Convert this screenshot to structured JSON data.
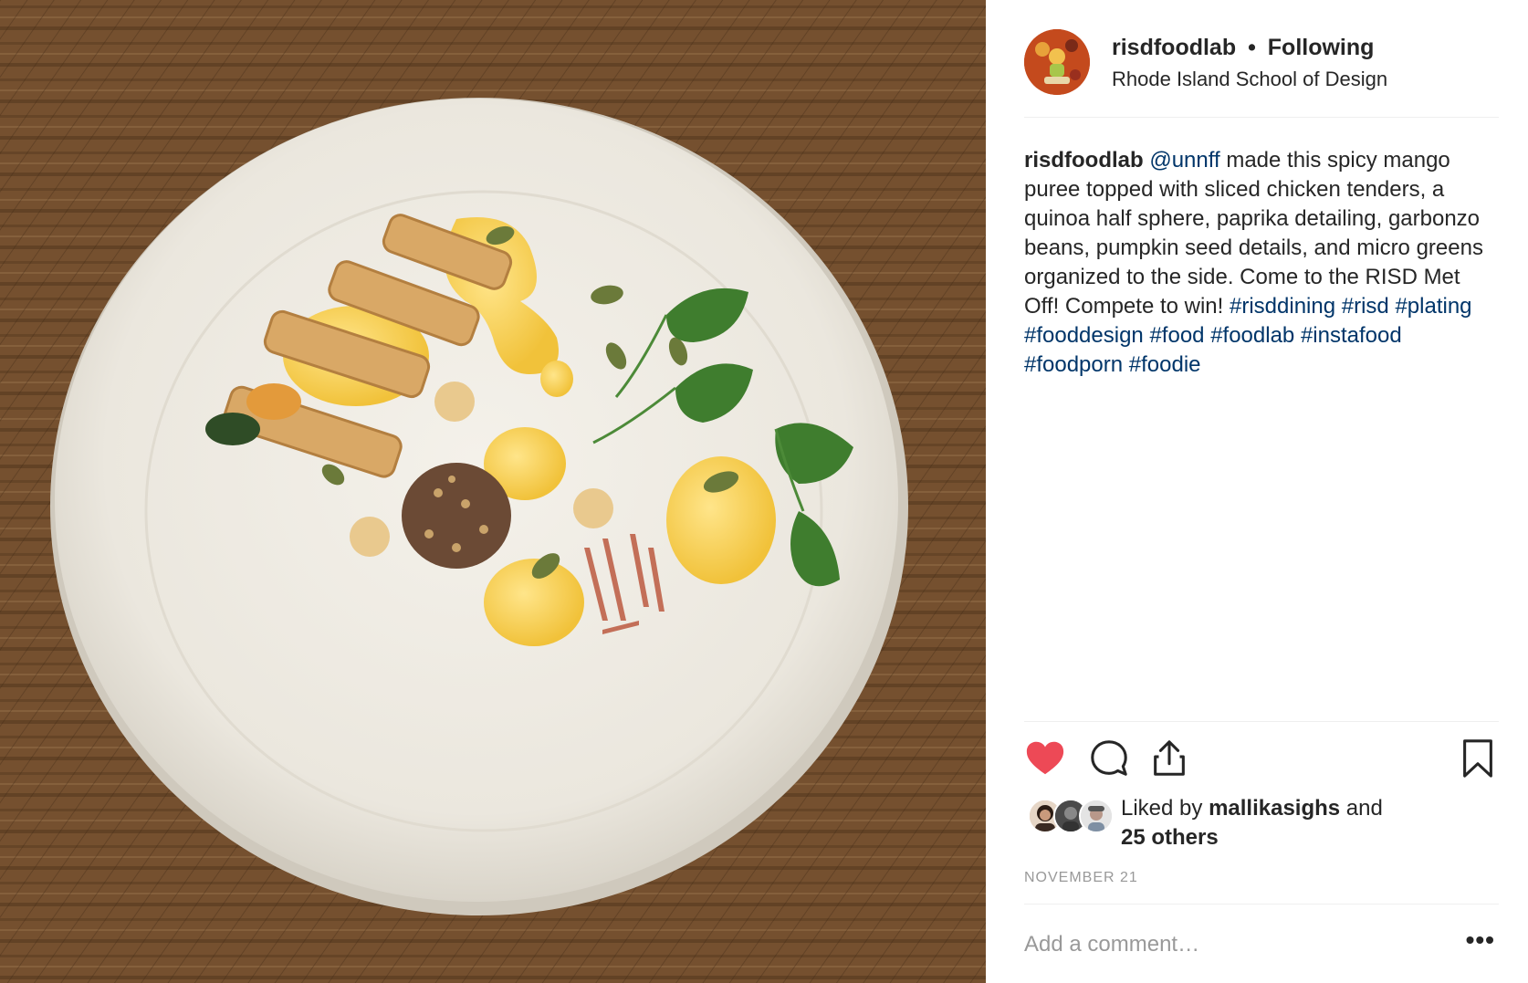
{
  "post": {
    "image_alt": "Plated dish on a white plate over a wooden table"
  },
  "header": {
    "username": "risdfoodlab",
    "separator": "•",
    "follow_status": "Following",
    "location": "Rhode Island School of Design",
    "avatar_icon": "profile-avatar"
  },
  "caption": {
    "author": "risdfoodlab",
    "mention": "@unnff",
    "text": " made this spicy mango puree topped with sliced chicken tenders, a quinoa half sphere, paprika detailing, garbonzo beans, pumpkin seed details, and micro greens organized to the side. Come to the RISD Met Off! Compete to win! ",
    "hashtags": [
      "#risddining",
      "#risd",
      "#plating",
      "#fooddesign",
      "#food",
      "#foodlab",
      "#instafood",
      "#foodporn",
      "#foodie"
    ]
  },
  "actions": {
    "like_icon": "heart-icon",
    "comment_icon": "comment-icon",
    "share_icon": "share-icon",
    "save_icon": "bookmark-icon",
    "liked": true,
    "like_color": "#ed4956"
  },
  "likes": {
    "prefix": "Liked by ",
    "user": "mallikasighs",
    "and": " and",
    "others": "25 others"
  },
  "date": "November 21",
  "comment": {
    "placeholder": "Add a comment…",
    "more": "•••"
  },
  "colors": {
    "text": "#262626",
    "link": "#003569",
    "muted": "#999999",
    "divider": "#efefef"
  }
}
